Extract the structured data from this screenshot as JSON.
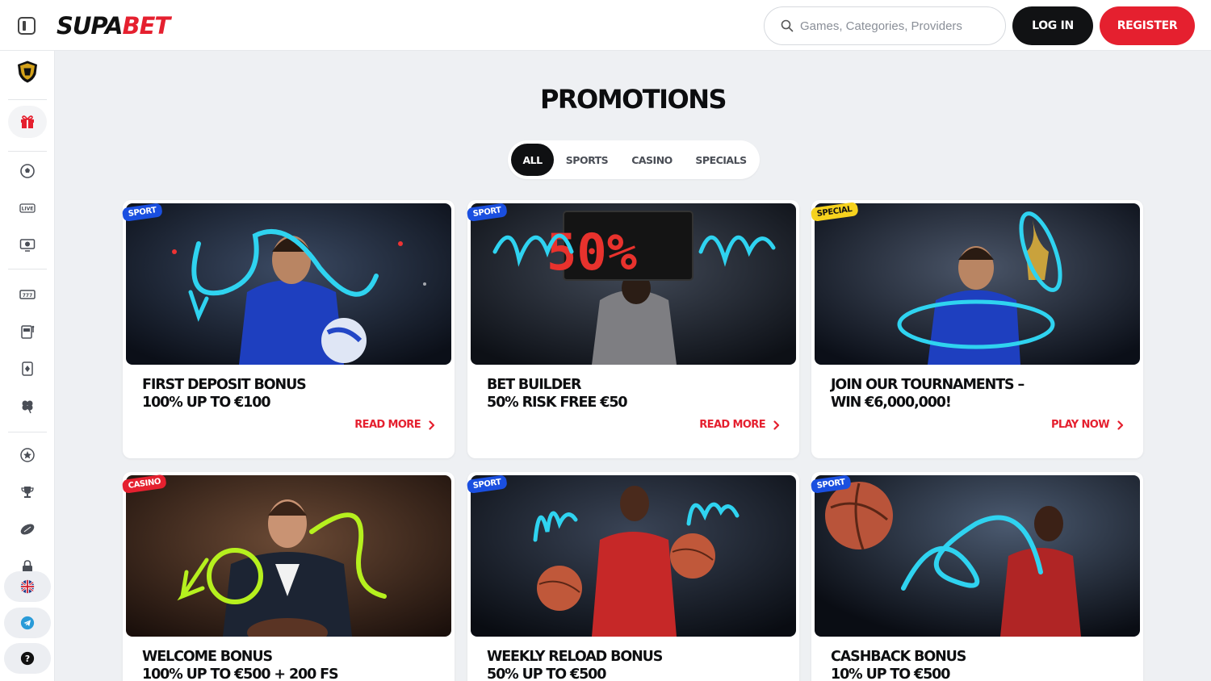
{
  "header": {
    "logo_part1": "SUPA",
    "logo_part2": "BET",
    "search_placeholder": "Games, Categories, Providers",
    "login_label": "LOG IN",
    "register_label": "REGISTER"
  },
  "sidebar": {
    "items": [
      {
        "icon": "club-crest-icon"
      },
      {
        "icon": "gift-icon",
        "active": true
      },
      {
        "icon": "football-icon"
      },
      {
        "icon": "live-icon",
        "label": "LIVE"
      },
      {
        "icon": "virtual-sports-icon"
      },
      {
        "icon": "slots-icon"
      },
      {
        "icon": "slot-machine-icon"
      },
      {
        "icon": "cards-icon"
      },
      {
        "icon": "clover-icon"
      },
      {
        "icon": "star-badge-icon"
      },
      {
        "icon": "trophy-icon"
      },
      {
        "icon": "rugby-ball-icon"
      },
      {
        "icon": "lock-icon"
      },
      {
        "icon": "uk-flag-icon"
      },
      {
        "icon": "telegram-icon"
      },
      {
        "icon": "help-icon",
        "label": "?"
      }
    ]
  },
  "main": {
    "title": "PROMOTIONS",
    "tabs": [
      {
        "label": "ALL",
        "active": true
      },
      {
        "label": "SPORTS"
      },
      {
        "label": "CASINO"
      },
      {
        "label": "SPECIALS"
      }
    ],
    "promotions": [
      {
        "badge": "SPORT",
        "title_line1": "FIRST DEPOSIT BONUS",
        "title_line2": "100% UP TO €100",
        "link": "READ MORE"
      },
      {
        "badge": "SPORT",
        "title_line1": "BET BUILDER",
        "title_line2": "50% RISK FREE €50",
        "link": "READ MORE",
        "board_text": "50%"
      },
      {
        "badge": "SPECIAL",
        "title_line1": "JOIN OUR TOURNAMENTS –",
        "title_line2": "WIN €6,000,000!",
        "link": "PLAY NOW"
      },
      {
        "badge": "CASINO",
        "title_line1": "WELCOME BONUS",
        "title_line2": "100% UP TO €500 + 200 FS"
      },
      {
        "badge": "SPORT",
        "title_line1": "WEEKLY RELOAD BONUS",
        "title_line2": "50% UP TO €500"
      },
      {
        "badge": "SPORT",
        "title_line1": "CASHBACK BONUS",
        "title_line2": "10% UP TO €500"
      }
    ]
  },
  "colors": {
    "brand_red": "#e5202f",
    "dark": "#111214",
    "sport_badge": "#1a4fe0",
    "special_badge": "#f6d21e",
    "accent_cyan": "#2fd3f0",
    "accent_lime": "#b6f01e"
  }
}
